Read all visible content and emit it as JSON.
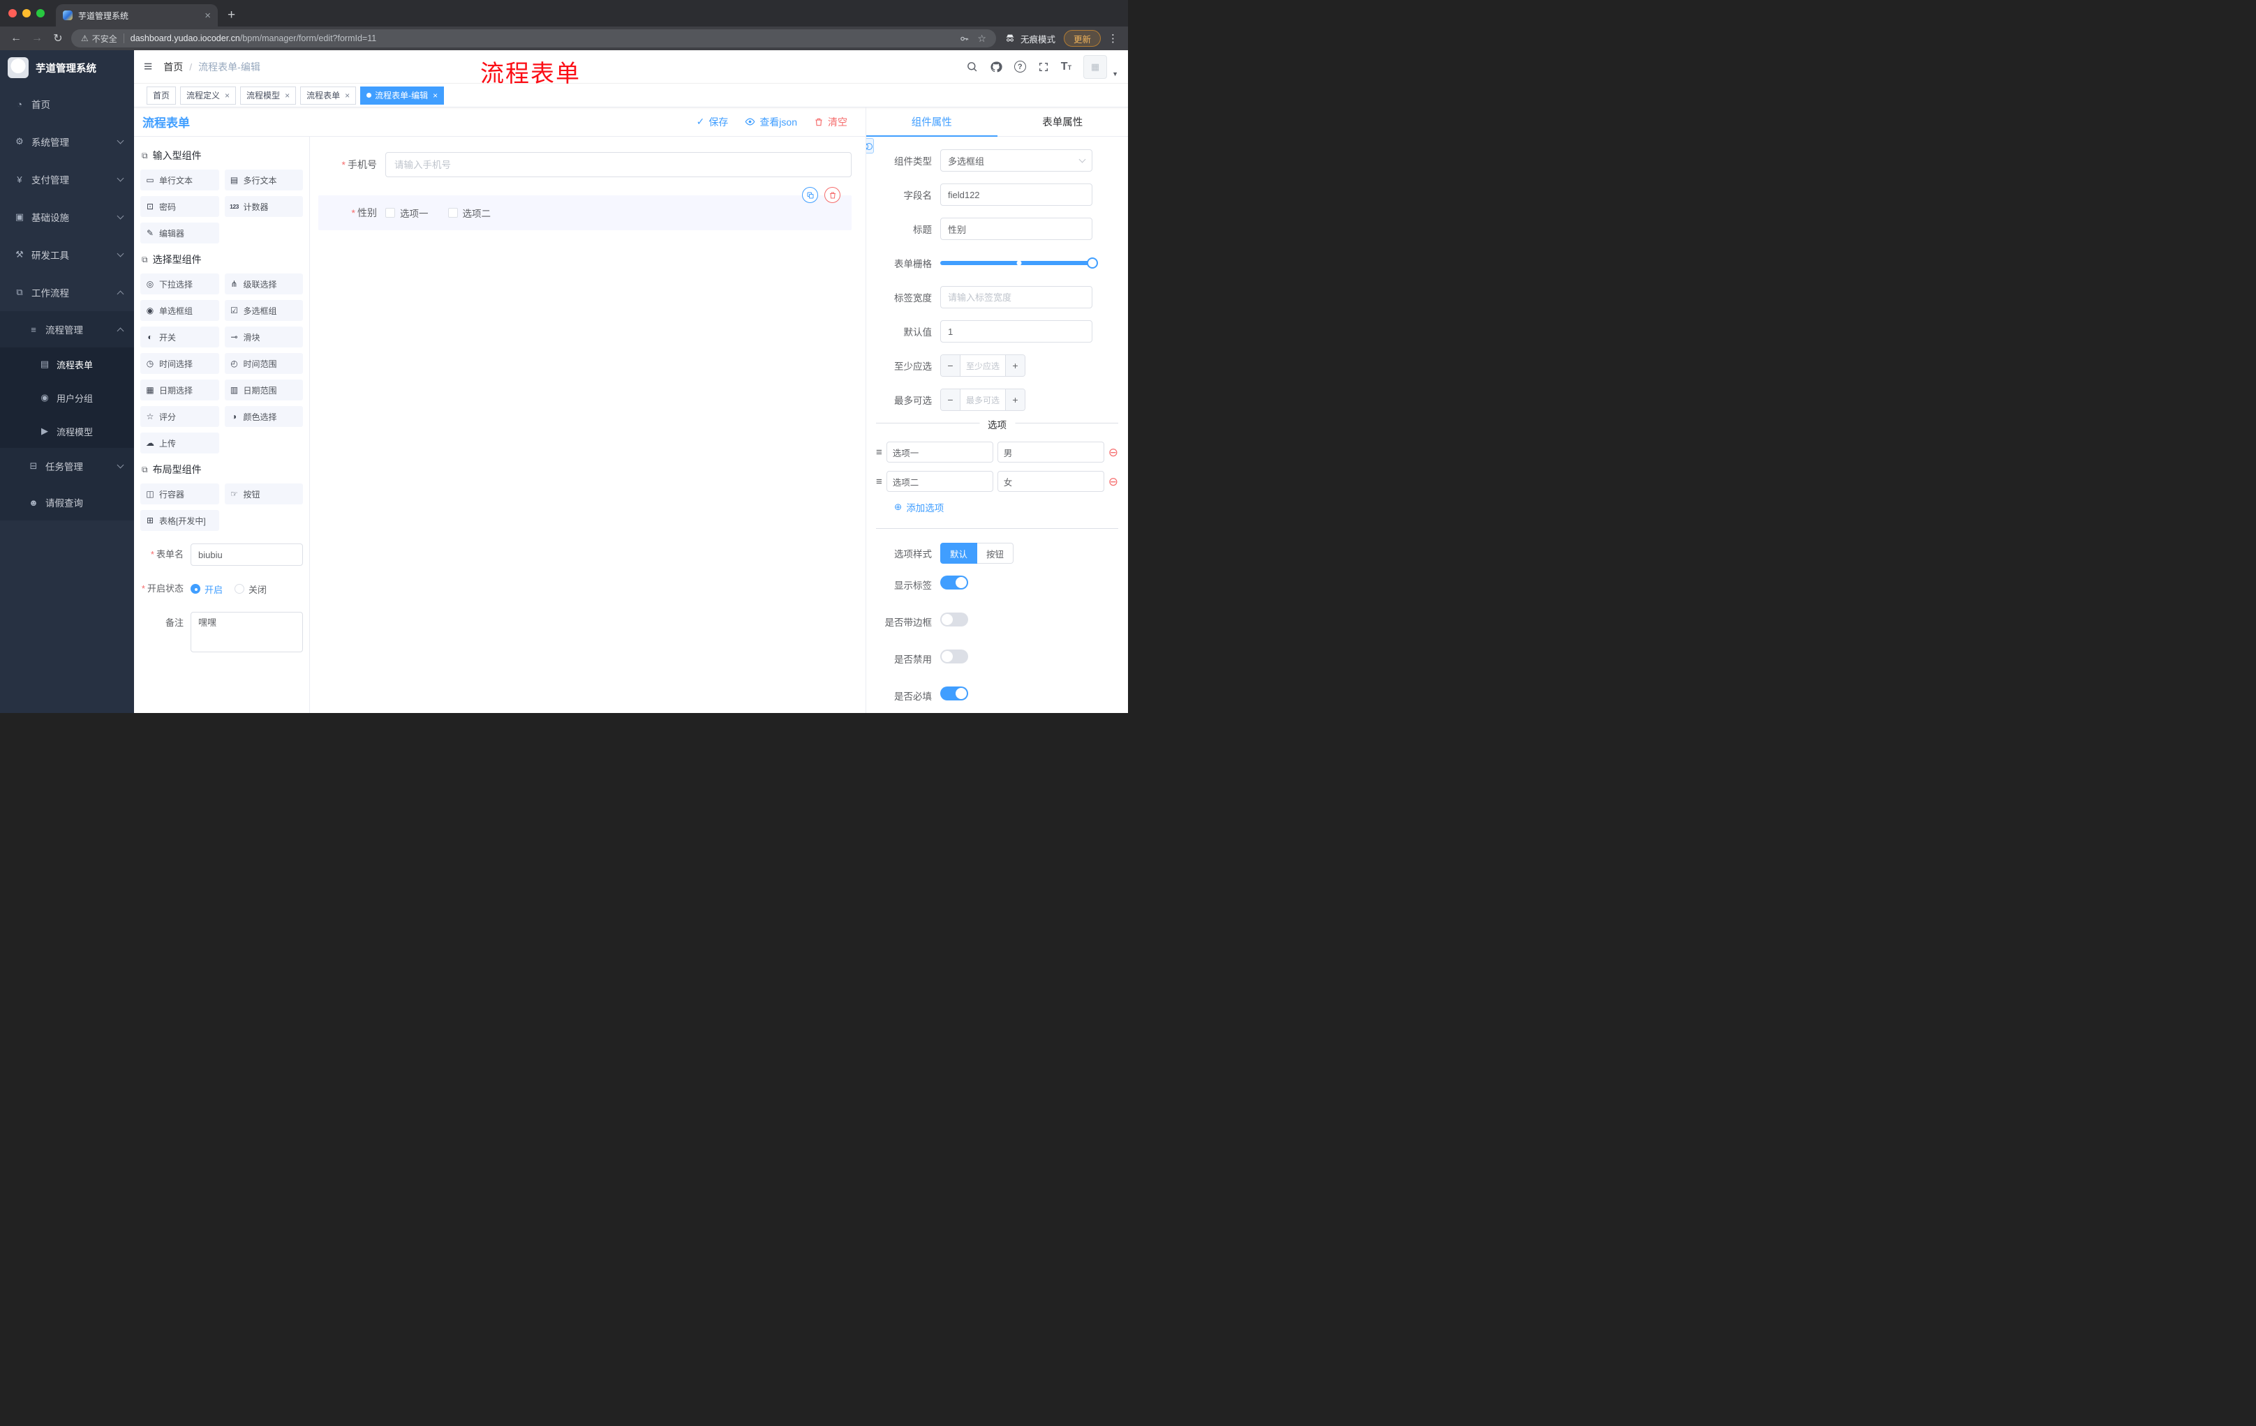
{
  "browser": {
    "tab_title": "芋道管理系统",
    "security_label": "不安全",
    "url_domain": "dashboard.yudao.iocoder.cn",
    "url_path": "/bpm/manager/form/edit?formId=11",
    "incognito_label": "无痕模式",
    "update_label": "更新"
  },
  "sidebar": {
    "logo_title": "芋道管理系统",
    "menu": [
      {
        "key": "home",
        "label": "首页",
        "icon": "dashboard",
        "level": 1
      },
      {
        "key": "system-management",
        "label": "系统管理",
        "icon": "gear",
        "level": 1,
        "expand": "down"
      },
      {
        "key": "payment-management",
        "label": "支付管理",
        "icon": "yen",
        "level": 1,
        "expand": "down"
      },
      {
        "key": "infrastructure",
        "label": "基础设施",
        "icon": "monitor",
        "level": 1,
        "expand": "down"
      },
      {
        "key": "dev-tools",
        "label": "研发工具",
        "icon": "tools",
        "level": 1,
        "expand": "down"
      },
      {
        "key": "workflow",
        "label": "工作流程",
        "icon": "workflow",
        "level": 1,
        "expand": "up"
      },
      {
        "key": "process-management",
        "label": "流程管理",
        "icon": "list",
        "level": 2,
        "expand": "up"
      },
      {
        "key": "process-form",
        "label": "流程表单",
        "icon": "form",
        "level": 3,
        "active": true
      },
      {
        "key": "user-group",
        "label": "用户分组",
        "icon": "users",
        "level": 3
      },
      {
        "key": "process-model",
        "label": "流程模型",
        "icon": "model",
        "level": 3
      },
      {
        "key": "task-management",
        "label": "任务管理",
        "icon": "tasks",
        "level": 2,
        "expand": "down"
      },
      {
        "key": "leave-query",
        "label": "请假查询",
        "icon": "person",
        "level": 2
      }
    ]
  },
  "header": {
    "breadcrumb_home": "首页",
    "breadcrumb_separator": "/",
    "breadcrumb_current": "流程表单-编辑",
    "annotation": "流程表单"
  },
  "tags": [
    {
      "key": "home",
      "label": "首页",
      "closable": false,
      "active": false
    },
    {
      "key": "process-definition",
      "label": "流程定义",
      "closable": true,
      "active": false
    },
    {
      "key": "process-model",
      "label": "流程模型",
      "closable": true,
      "active": false
    },
    {
      "key": "process-form",
      "label": "流程表单",
      "closable": true,
      "active": false
    },
    {
      "key": "process-form-edit",
      "label": "流程表单-编辑",
      "closable": true,
      "active": true
    }
  ],
  "editor": {
    "title": "流程表单",
    "tools": {
      "save": "保存",
      "view_json": "查看json",
      "clear": "清空"
    },
    "palette": {
      "sections": [
        {
          "key": "input",
          "title": "输入型组件",
          "items": [
            {
              "key": "single-text",
              "label": "单行文本"
            },
            {
              "key": "multi-text",
              "label": "多行文本"
            },
            {
              "key": "password",
              "label": "密码"
            },
            {
              "key": "counter",
              "label": "计数器"
            },
            {
              "key": "editor",
              "label": "编辑器"
            }
          ]
        },
        {
          "key": "select",
          "title": "选择型组件",
          "items": [
            {
              "key": "dropdown",
              "label": "下拉选择"
            },
            {
              "key": "cascader",
              "label": "级联选择"
            },
            {
              "key": "radio-group",
              "label": "单选框组"
            },
            {
              "key": "checkbox-group",
              "label": "多选框组"
            },
            {
              "key": "switch",
              "label": "开关"
            },
            {
              "key": "slider",
              "label": "滑块"
            },
            {
              "key": "time-picker",
              "label": "时间选择"
            },
            {
              "key": "time-range",
              "label": "时间范围"
            },
            {
              "key": "date-picker",
              "label": "日期选择"
            },
            {
              "key": "date-range",
              "label": "日期范围"
            },
            {
              "key": "rate",
              "label": "评分"
            },
            {
              "key": "color-picker",
              "label": "颜色选择"
            },
            {
              "key": "upload",
              "label": "上传"
            }
          ]
        },
        {
          "key": "layout",
          "title": "布局型组件",
          "items": [
            {
              "key": "row-container",
              "label": "行容器"
            },
            {
              "key": "button",
              "label": "按钮"
            },
            {
              "key": "table",
              "label": "表格[开发中]"
            }
          ]
        }
      ]
    },
    "left_form": {
      "name": {
        "label": "表单名",
        "value": "biubiu"
      },
      "status": {
        "label": "开启状态",
        "on_label": "开启",
        "off_label": "关闭"
      },
      "remark": {
        "label": "备注",
        "value": "嘿嘿"
      }
    },
    "canvas": {
      "mobile": {
        "label": "手机号",
        "placeholder": "请输入手机号"
      },
      "gender": {
        "label": "性别",
        "options": [
          "选项一",
          "选项二"
        ]
      }
    }
  },
  "props": {
    "tabs": [
      {
        "key": "component",
        "label": "组件属性",
        "active": true
      },
      {
        "key": "form",
        "label": "表单属性",
        "active": false
      }
    ],
    "component_type": {
      "label": "组件类型",
      "value": "多选框组"
    },
    "field_name": {
      "label": "字段名",
      "value": "field122"
    },
    "title_field": {
      "label": "标题",
      "value": "性别"
    },
    "grid": {
      "label": "表单栅格"
    },
    "label_width": {
      "label": "标签宽度",
      "placeholder": "请输入标签宽度"
    },
    "default_value": {
      "label": "默认值",
      "value": "1"
    },
    "min_select": {
      "label": "至少应选",
      "placeholder": "至少应选"
    },
    "max_select": {
      "label": "最多可选",
      "placeholder": "最多可选"
    },
    "options_title": "选项",
    "options": [
      {
        "label": "选项一",
        "value": "男"
      },
      {
        "label": "选项二",
        "value": "女"
      }
    ],
    "add_option": "添加选项",
    "option_style": {
      "label": "选项样式",
      "choices": [
        "默认",
        "按钮"
      ],
      "selected": "默认"
    },
    "switches": [
      {
        "key": "show-label",
        "label": "显示标签",
        "on": true
      },
      {
        "key": "with-border",
        "label": "是否带边框",
        "on": false
      },
      {
        "key": "disabled",
        "label": "是否禁用",
        "on": false
      },
      {
        "key": "required",
        "label": "是否必填",
        "on": true
      }
    ]
  },
  "colors": {
    "primary": "#409EFF",
    "danger": "#F56C6C",
    "annotation_red": "#FB0D15"
  }
}
